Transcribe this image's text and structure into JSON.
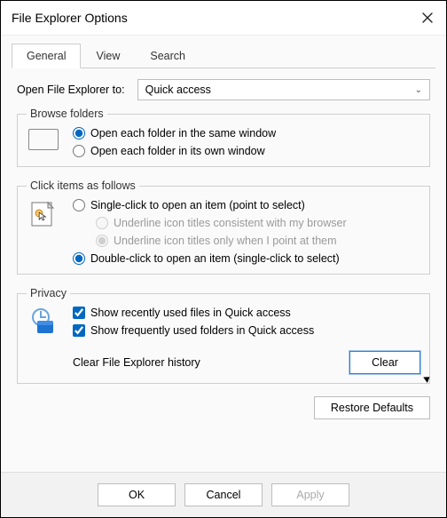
{
  "window": {
    "title": "File Explorer Options"
  },
  "tabs": [
    "General",
    "View",
    "Search"
  ],
  "active_tab": 0,
  "open_to": {
    "label": "Open File Explorer to:",
    "value": "Quick access"
  },
  "browse_folders": {
    "legend": "Browse folders",
    "options": [
      {
        "label": "Open each folder in the same window",
        "checked": true
      },
      {
        "label": "Open each folder in its own window",
        "checked": false
      }
    ]
  },
  "click_items": {
    "legend": "Click items as follows",
    "single": {
      "label": "Single-click to open an item (point to select)",
      "checked": false
    },
    "underline_browser": {
      "label": "Underline icon titles consistent with my browser",
      "checked": false,
      "disabled": true
    },
    "underline_point": {
      "label": "Underline icon titles only when I point at them",
      "checked": true,
      "disabled": true
    },
    "double": {
      "label": "Double-click to open an item (single-click to select)",
      "checked": true
    }
  },
  "privacy": {
    "legend": "Privacy",
    "recent_files": {
      "label": "Show recently used files in Quick access",
      "checked": true
    },
    "frequent_folders": {
      "label": "Show frequently used folders in Quick access",
      "checked": true
    },
    "clear_label": "Clear File Explorer history",
    "clear_button": "Clear"
  },
  "buttons": {
    "defaults": "Restore Defaults",
    "ok": "OK",
    "cancel": "Cancel",
    "apply": "Apply"
  }
}
